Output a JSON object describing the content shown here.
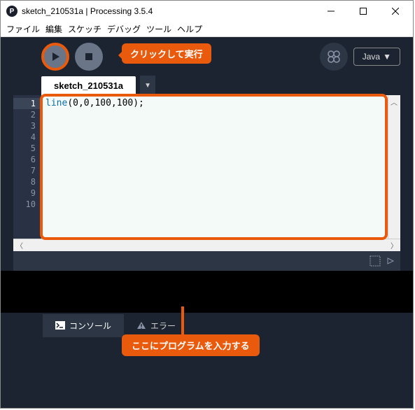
{
  "window": {
    "title": "sketch_210531a | Processing 3.5.4"
  },
  "menu": {
    "file": "ファイル",
    "edit": "編集",
    "sketch": "スケッチ",
    "debug": "デバッグ",
    "tools": "ツール",
    "help": "ヘルプ"
  },
  "toolbar": {
    "mode": "Java"
  },
  "tab": {
    "name": "sketch_210531a"
  },
  "code": {
    "keyword": "line",
    "rest": "(0,0,100,100);"
  },
  "gutter": {
    "lines": [
      "1",
      "2",
      "3",
      "4",
      "5",
      "6",
      "7",
      "8",
      "9",
      "10"
    ]
  },
  "annotations": {
    "run": "クリックして実行",
    "code_area": "ここにプログラムを入力する"
  },
  "console": {
    "tab1": "コンソール",
    "tab2": "エラー"
  }
}
